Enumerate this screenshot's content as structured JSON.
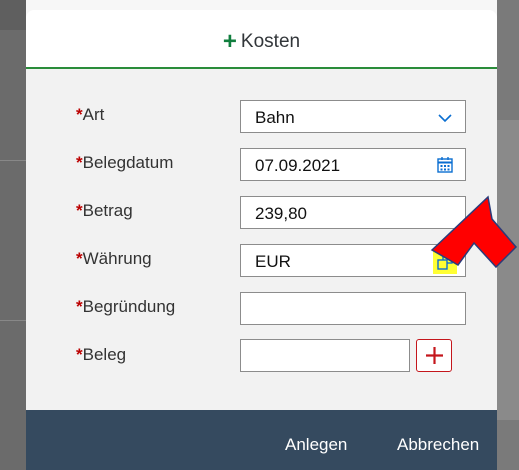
{
  "dialog": {
    "title": "Kosten",
    "title_icon": "plus-icon"
  },
  "form": {
    "required_marker": "*",
    "rows": [
      {
        "label": "Art",
        "value": "Bahn",
        "control": "select",
        "icon": "chevron-down-icon"
      },
      {
        "label": "Belegdatum",
        "value": "07.09.2021",
        "control": "date",
        "icon": "calendar-icon"
      },
      {
        "label": "Betrag",
        "value": "239,80",
        "control": "input"
      },
      {
        "label": "Währung",
        "value": "EUR",
        "control": "value-help",
        "icon": "value-help-icon"
      },
      {
        "label": "Begründung",
        "value": "",
        "control": "input"
      },
      {
        "label": "Beleg",
        "value": "",
        "control": "upload",
        "icon": "add-icon"
      }
    ]
  },
  "footer": {
    "create_label": "Anlegen",
    "cancel_label": "Abbrechen"
  },
  "colors": {
    "accent_green": "#107e3e",
    "required_red": "#bb0000",
    "footer_bg": "#354a5f",
    "highlight": "#ffff33",
    "annotation_arrow": "#ff0000"
  }
}
